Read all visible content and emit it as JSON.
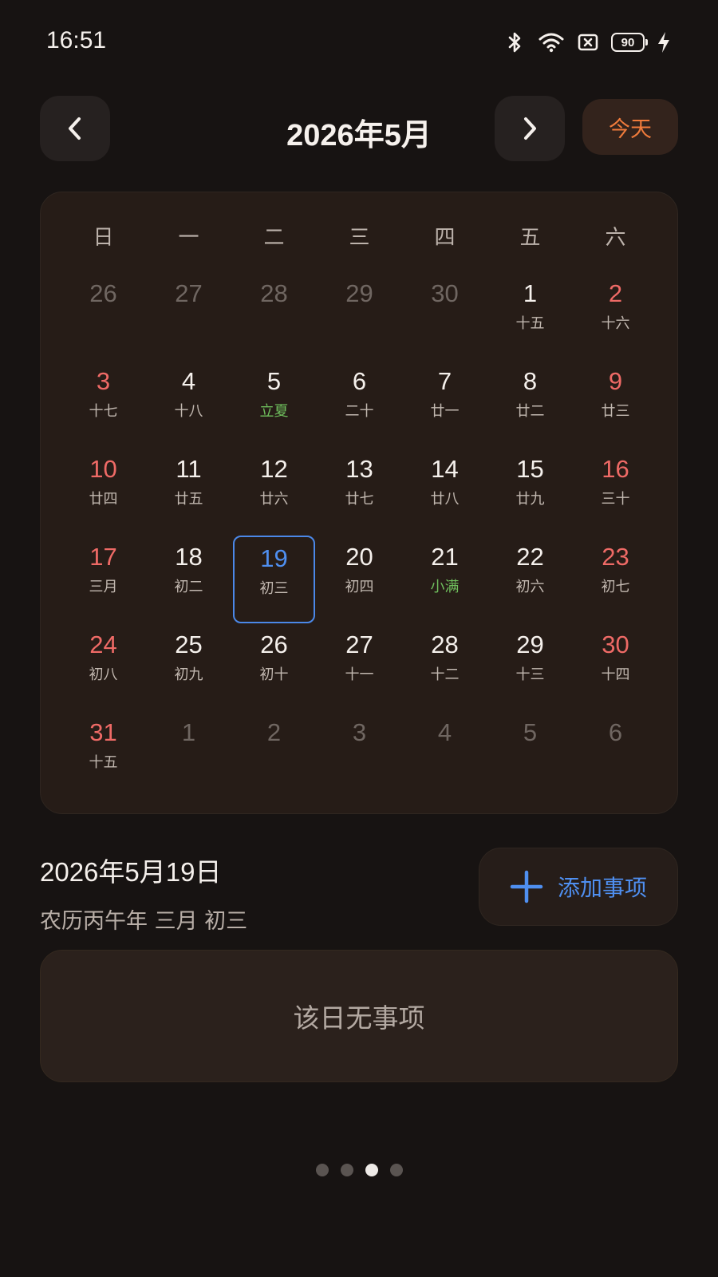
{
  "status_bar": {
    "time": "16:51",
    "battery": "90",
    "icons": [
      "bluetooth-icon",
      "wifi-icon",
      "sim-off-icon",
      "battery-icon",
      "charging-icon"
    ]
  },
  "header": {
    "title": "2026年5月",
    "today_label": "今天",
    "prev_icon": "chevron-left-icon",
    "next_icon": "chevron-right-icon"
  },
  "calendar": {
    "weekdays": [
      "日",
      "一",
      "二",
      "三",
      "四",
      "五",
      "六"
    ],
    "weeks": [
      [
        {
          "num": "26",
          "lunar": "",
          "type": "other"
        },
        {
          "num": "27",
          "lunar": "",
          "type": "other"
        },
        {
          "num": "28",
          "lunar": "",
          "type": "other"
        },
        {
          "num": "29",
          "lunar": "",
          "type": "other"
        },
        {
          "num": "30",
          "lunar": "",
          "type": "other"
        },
        {
          "num": "1",
          "lunar": "十五",
          "type": "normal"
        },
        {
          "num": "2",
          "lunar": "十六",
          "type": "weekend"
        }
      ],
      [
        {
          "num": "3",
          "lunar": "十七",
          "type": "weekend"
        },
        {
          "num": "4",
          "lunar": "十八",
          "type": "normal"
        },
        {
          "num": "5",
          "lunar": "立夏",
          "type": "term"
        },
        {
          "num": "6",
          "lunar": "二十",
          "type": "normal"
        },
        {
          "num": "7",
          "lunar": "廿一",
          "type": "normal"
        },
        {
          "num": "8",
          "lunar": "廿二",
          "type": "normal"
        },
        {
          "num": "9",
          "lunar": "廿三",
          "type": "weekend"
        }
      ],
      [
        {
          "num": "10",
          "lunar": "廿四",
          "type": "weekend"
        },
        {
          "num": "11",
          "lunar": "廿五",
          "type": "normal"
        },
        {
          "num": "12",
          "lunar": "廿六",
          "type": "normal"
        },
        {
          "num": "13",
          "lunar": "廿七",
          "type": "normal"
        },
        {
          "num": "14",
          "lunar": "廿八",
          "type": "normal"
        },
        {
          "num": "15",
          "lunar": "廿九",
          "type": "normal"
        },
        {
          "num": "16",
          "lunar": "三十",
          "type": "weekend"
        }
      ],
      [
        {
          "num": "17",
          "lunar": "三月",
          "type": "weekend"
        },
        {
          "num": "18",
          "lunar": "初二",
          "type": "normal"
        },
        {
          "num": "19",
          "lunar": "初三",
          "type": "selected"
        },
        {
          "num": "20",
          "lunar": "初四",
          "type": "normal"
        },
        {
          "num": "21",
          "lunar": "小满",
          "type": "term"
        },
        {
          "num": "22",
          "lunar": "初六",
          "type": "normal"
        },
        {
          "num": "23",
          "lunar": "初七",
          "type": "weekend"
        }
      ],
      [
        {
          "num": "24",
          "lunar": "初八",
          "type": "weekend"
        },
        {
          "num": "25",
          "lunar": "初九",
          "type": "normal"
        },
        {
          "num": "26",
          "lunar": "初十",
          "type": "normal"
        },
        {
          "num": "27",
          "lunar": "十一",
          "type": "normal"
        },
        {
          "num": "28",
          "lunar": "十二",
          "type": "normal"
        },
        {
          "num": "29",
          "lunar": "十三",
          "type": "normal"
        },
        {
          "num": "30",
          "lunar": "十四",
          "type": "weekend"
        }
      ],
      [
        {
          "num": "31",
          "lunar": "十五",
          "type": "weekend"
        },
        {
          "num": "1",
          "lunar": "",
          "type": "other"
        },
        {
          "num": "2",
          "lunar": "",
          "type": "other"
        },
        {
          "num": "3",
          "lunar": "",
          "type": "other"
        },
        {
          "num": "4",
          "lunar": "",
          "type": "other"
        },
        {
          "num": "5",
          "lunar": "",
          "type": "other"
        },
        {
          "num": "6",
          "lunar": "",
          "type": "other"
        }
      ]
    ]
  },
  "selected_day": {
    "date": "2026年5月19日",
    "lunar": "农历丙午年 三月 初三"
  },
  "add_button": {
    "label": "添加事项",
    "icon": "plus-icon"
  },
  "events": {
    "empty_label": "该日无事项"
  },
  "pager": {
    "count": 4,
    "active": 3
  },
  "colors": {
    "background": "#171312",
    "card": "#261c17",
    "accent_blue": "#4f8ff0",
    "accent_orange": "#f07b3b",
    "weekend_red": "#ee6a66",
    "solar_term_green": "#6fbf5d"
  }
}
